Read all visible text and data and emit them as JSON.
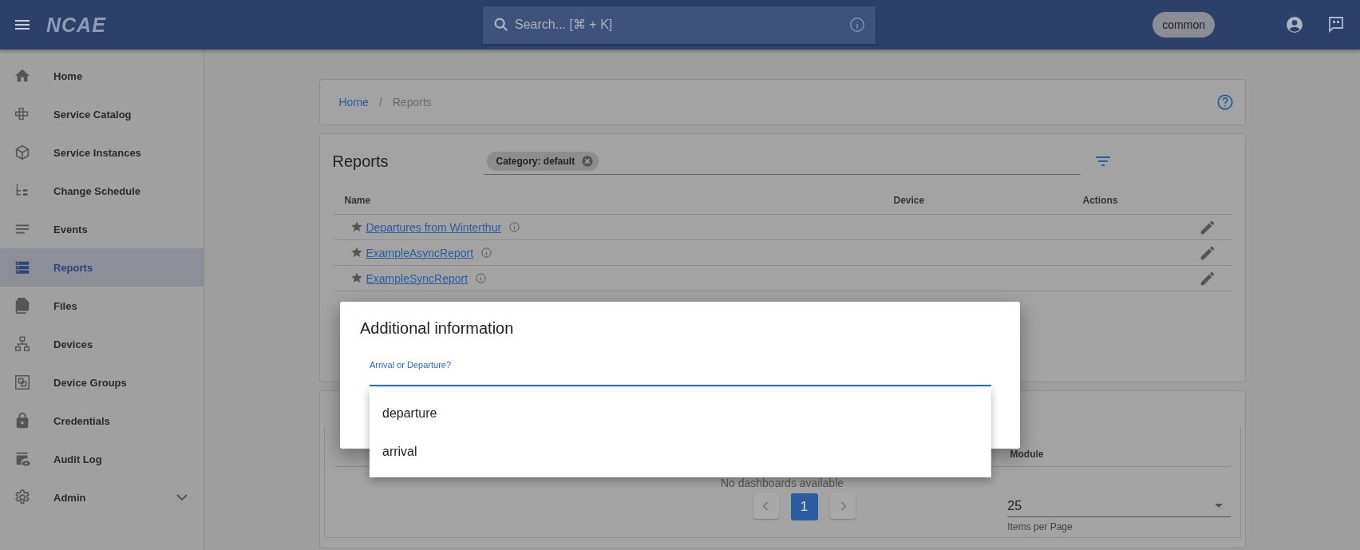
{
  "app_bar": {
    "logo": "NCAE",
    "search": {
      "placeholder": "Search... [⌘ + K]"
    },
    "tenant": "common"
  },
  "sidebar": {
    "items": [
      {
        "label": "Home",
        "selected": false
      },
      {
        "label": "Service Catalog",
        "selected": false
      },
      {
        "label": "Service Instances",
        "selected": false
      },
      {
        "label": "Change Schedule",
        "selected": false
      },
      {
        "label": "Events",
        "selected": false
      },
      {
        "label": "Reports",
        "selected": true
      },
      {
        "label": "Files",
        "selected": false
      },
      {
        "label": "Devices",
        "selected": false
      },
      {
        "label": "Device Groups",
        "selected": false
      },
      {
        "label": "Credentials",
        "selected": false
      },
      {
        "label": "Audit Log",
        "selected": false
      },
      {
        "label": "Admin",
        "selected": false,
        "expandable": true
      }
    ]
  },
  "breadcrumb": {
    "items": [
      "Home",
      "Reports"
    ],
    "separator": "/"
  },
  "reports": {
    "title": "Reports",
    "filter_chip": "Category: default",
    "columns": [
      "Name",
      "Device",
      "Actions"
    ],
    "rows": [
      {
        "name": "Departures from Winterthur",
        "starred": true
      },
      {
        "name": "ExampleAsyncReport",
        "starred": true
      },
      {
        "name": "ExampleSyncReport",
        "starred": true
      }
    ]
  },
  "dashboards": {
    "columns": [
      "Module"
    ],
    "empty_text": "No dashboards available",
    "pages": [
      {
        "label": "1",
        "selected": true
      }
    ],
    "page_size": "25",
    "page_size_label": "Items per Page"
  },
  "dialog": {
    "title": "Additional information",
    "field": {
      "label": "Arrival or Departure?",
      "focused": true
    },
    "options": [
      "departure",
      "arrival"
    ]
  }
}
